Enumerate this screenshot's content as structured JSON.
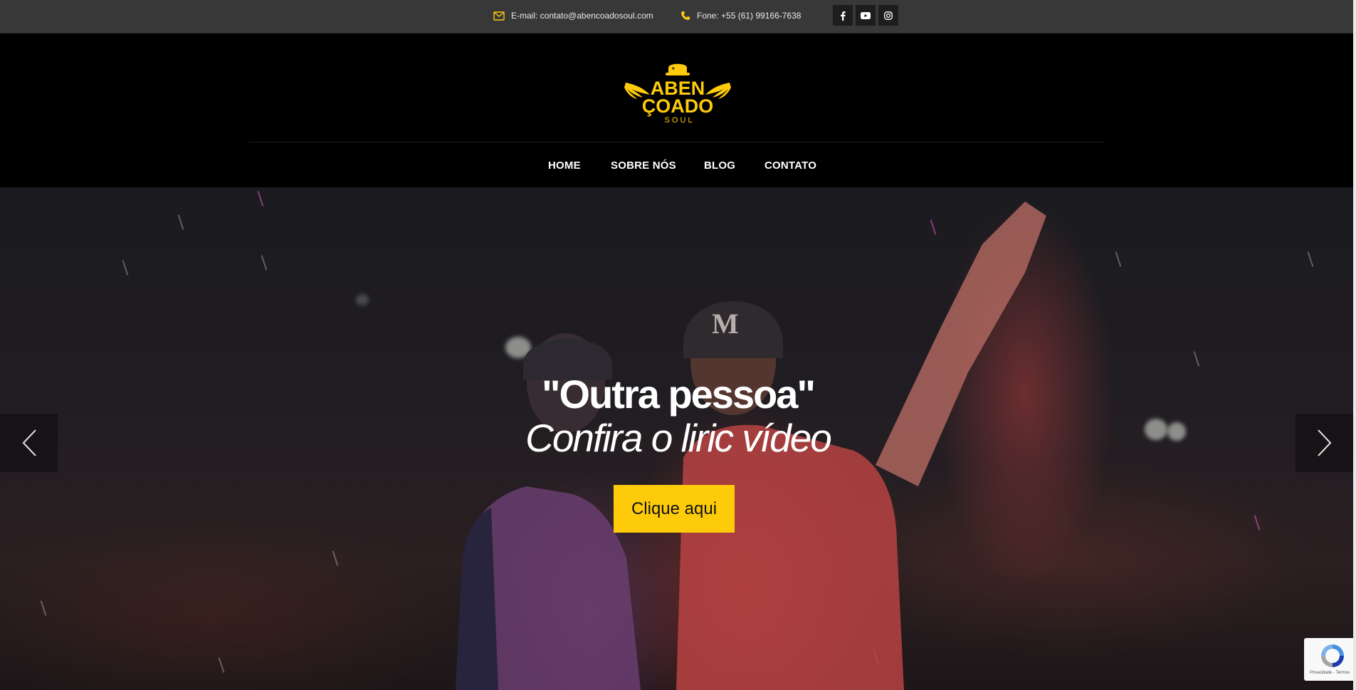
{
  "topbar": {
    "email": "E-mail: contato@abencoadosoul.com",
    "phone": "Fone: +55 (61) 99166-7638",
    "socials": [
      "facebook-icon",
      "youtube-icon",
      "instagram-icon"
    ]
  },
  "logo": {
    "line1": "ABEN",
    "line2": "ÇOADO",
    "line3": "S O U L"
  },
  "nav": {
    "items": [
      {
        "label": "HOME"
      },
      {
        "label": "SOBRE NÓS"
      },
      {
        "label": "BLOG"
      },
      {
        "label": "CONTATO"
      }
    ]
  },
  "hero": {
    "title": "\"Outra pessoa\"",
    "subtitle": "Confira o liric vídeo",
    "cta_label": "Clique aqui",
    "prev_icon": "chevron-left-icon",
    "next_icon": "chevron-right-icon"
  },
  "recaptcha": {
    "terms": "Privacidade - Termos"
  },
  "colors": {
    "accent": "#fdcb0a",
    "topbar_bg": "#383838",
    "header_bg": "#000000"
  }
}
